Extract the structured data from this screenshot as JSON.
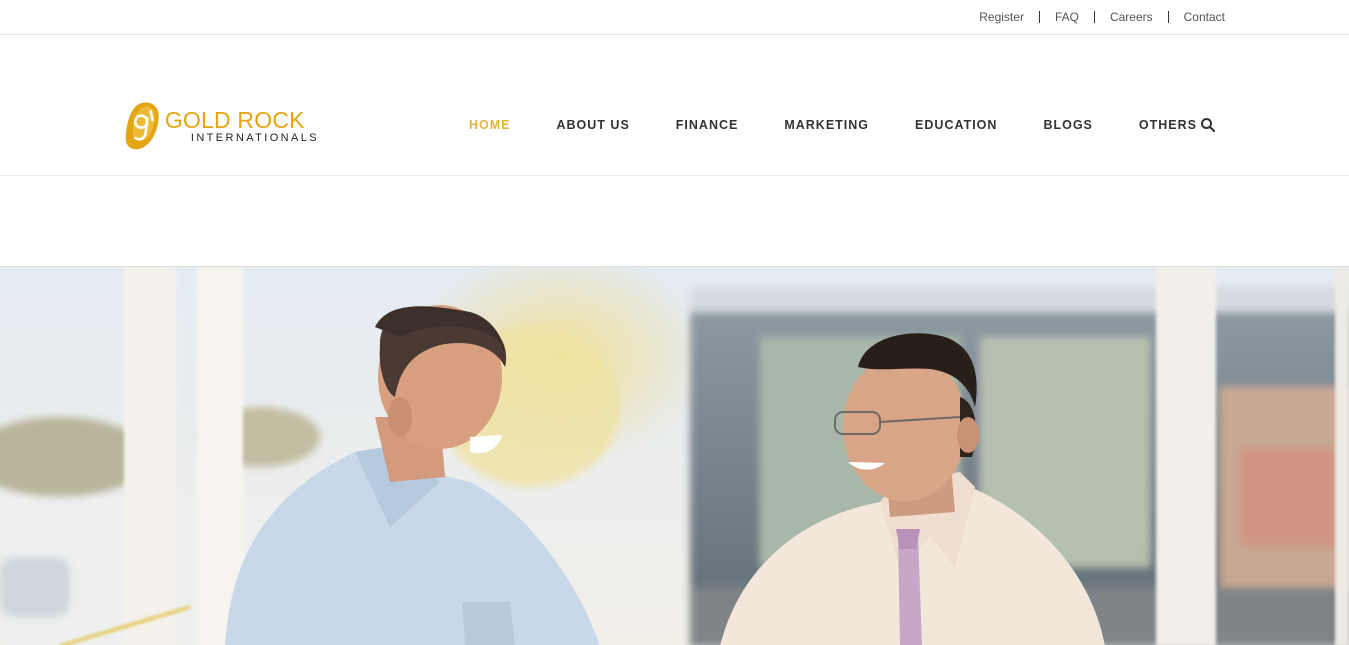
{
  "top_links": [
    "Register",
    "FAQ",
    "Careers",
    "Contact"
  ],
  "logo": {
    "name": "GOLD ROCK",
    "sub": "INTERNATIONALS",
    "mark_letter": "g"
  },
  "nav": {
    "items": [
      "HOME",
      "ABOUT US",
      "FINANCE",
      "MARKETING",
      "EDUCATION",
      "BLOGS",
      "OTHERS"
    ],
    "active": "HOME"
  },
  "colors": {
    "brand_gold": "#e3a511",
    "nav_active": "#e3b341",
    "nav_text": "#333333",
    "shirt_blue": "#c9d8e8",
    "shirt_cream": "#f3e6da",
    "tie_pink": "#c8a6c8"
  },
  "icons": {
    "search": "search-icon"
  },
  "hero": {
    "alt": "two-men-smiling-photo"
  }
}
